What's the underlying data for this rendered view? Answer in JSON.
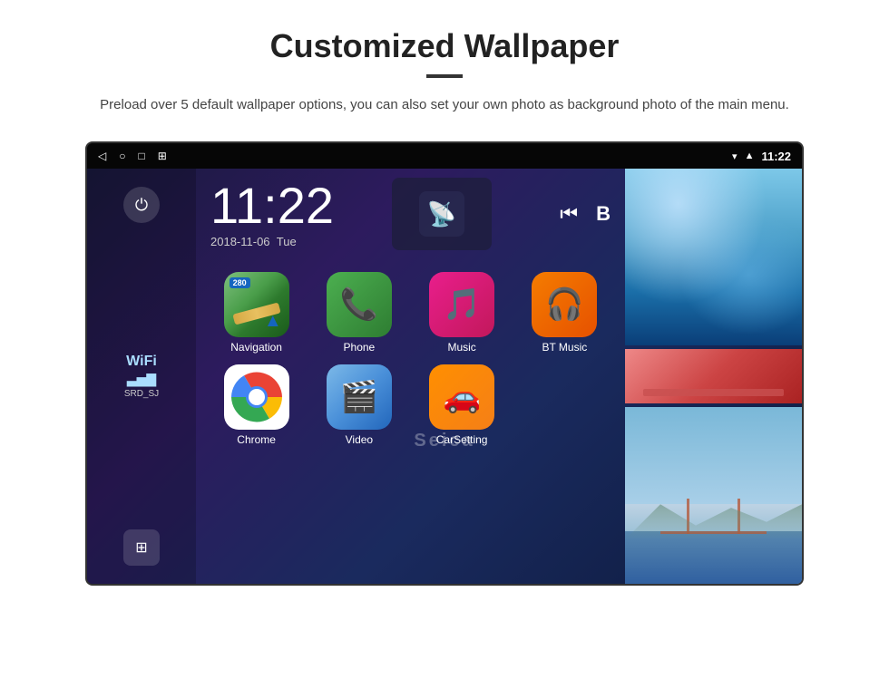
{
  "page": {
    "title": "Customized Wallpaper",
    "description": "Preload over 5 default wallpaper options, you can also set your own photo as background photo of the main menu.",
    "watermark": "Seica"
  },
  "status_bar": {
    "back_icon": "◁",
    "home_icon": "○",
    "recent_icon": "□",
    "screenshot_icon": "⊞",
    "location_icon": "▾",
    "signal_icon": "▲",
    "time": "11:22"
  },
  "clock": {
    "time": "11:22",
    "date": "2018-11-06",
    "day": "Tue"
  },
  "wifi": {
    "label": "WiFi",
    "bars": "▃▅▇",
    "ssid": "SRD_SJ"
  },
  "apps": [
    {
      "id": "navigation",
      "label": "Navigation",
      "badge": "280"
    },
    {
      "id": "phone",
      "label": "Phone"
    },
    {
      "id": "music",
      "label": "Music"
    },
    {
      "id": "bt-music",
      "label": "BT Music"
    },
    {
      "id": "chrome",
      "label": "Chrome"
    },
    {
      "id": "video",
      "label": "Video"
    },
    {
      "id": "carsetting",
      "label": "CarSetting"
    }
  ]
}
